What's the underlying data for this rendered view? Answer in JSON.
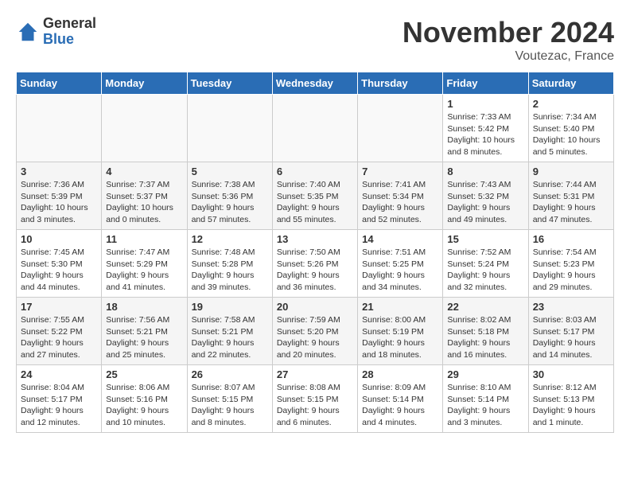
{
  "logo": {
    "general": "General",
    "blue": "Blue"
  },
  "title": "November 2024",
  "location": "Voutezac, France",
  "days_of_week": [
    "Sunday",
    "Monday",
    "Tuesday",
    "Wednesday",
    "Thursday",
    "Friday",
    "Saturday"
  ],
  "weeks": [
    [
      {
        "num": "",
        "info": ""
      },
      {
        "num": "",
        "info": ""
      },
      {
        "num": "",
        "info": ""
      },
      {
        "num": "",
        "info": ""
      },
      {
        "num": "",
        "info": ""
      },
      {
        "num": "1",
        "info": "Sunrise: 7:33 AM\nSunset: 5:42 PM\nDaylight: 10 hours\nand 8 minutes."
      },
      {
        "num": "2",
        "info": "Sunrise: 7:34 AM\nSunset: 5:40 PM\nDaylight: 10 hours\nand 5 minutes."
      }
    ],
    [
      {
        "num": "3",
        "info": "Sunrise: 7:36 AM\nSunset: 5:39 PM\nDaylight: 10 hours\nand 3 minutes."
      },
      {
        "num": "4",
        "info": "Sunrise: 7:37 AM\nSunset: 5:37 PM\nDaylight: 10 hours\nand 0 minutes."
      },
      {
        "num": "5",
        "info": "Sunrise: 7:38 AM\nSunset: 5:36 PM\nDaylight: 9 hours\nand 57 minutes."
      },
      {
        "num": "6",
        "info": "Sunrise: 7:40 AM\nSunset: 5:35 PM\nDaylight: 9 hours\nand 55 minutes."
      },
      {
        "num": "7",
        "info": "Sunrise: 7:41 AM\nSunset: 5:34 PM\nDaylight: 9 hours\nand 52 minutes."
      },
      {
        "num": "8",
        "info": "Sunrise: 7:43 AM\nSunset: 5:32 PM\nDaylight: 9 hours\nand 49 minutes."
      },
      {
        "num": "9",
        "info": "Sunrise: 7:44 AM\nSunset: 5:31 PM\nDaylight: 9 hours\nand 47 minutes."
      }
    ],
    [
      {
        "num": "10",
        "info": "Sunrise: 7:45 AM\nSunset: 5:30 PM\nDaylight: 9 hours\nand 44 minutes."
      },
      {
        "num": "11",
        "info": "Sunrise: 7:47 AM\nSunset: 5:29 PM\nDaylight: 9 hours\nand 41 minutes."
      },
      {
        "num": "12",
        "info": "Sunrise: 7:48 AM\nSunset: 5:28 PM\nDaylight: 9 hours\nand 39 minutes."
      },
      {
        "num": "13",
        "info": "Sunrise: 7:50 AM\nSunset: 5:26 PM\nDaylight: 9 hours\nand 36 minutes."
      },
      {
        "num": "14",
        "info": "Sunrise: 7:51 AM\nSunset: 5:25 PM\nDaylight: 9 hours\nand 34 minutes."
      },
      {
        "num": "15",
        "info": "Sunrise: 7:52 AM\nSunset: 5:24 PM\nDaylight: 9 hours\nand 32 minutes."
      },
      {
        "num": "16",
        "info": "Sunrise: 7:54 AM\nSunset: 5:23 PM\nDaylight: 9 hours\nand 29 minutes."
      }
    ],
    [
      {
        "num": "17",
        "info": "Sunrise: 7:55 AM\nSunset: 5:22 PM\nDaylight: 9 hours\nand 27 minutes."
      },
      {
        "num": "18",
        "info": "Sunrise: 7:56 AM\nSunset: 5:21 PM\nDaylight: 9 hours\nand 25 minutes."
      },
      {
        "num": "19",
        "info": "Sunrise: 7:58 AM\nSunset: 5:21 PM\nDaylight: 9 hours\nand 22 minutes."
      },
      {
        "num": "20",
        "info": "Sunrise: 7:59 AM\nSunset: 5:20 PM\nDaylight: 9 hours\nand 20 minutes."
      },
      {
        "num": "21",
        "info": "Sunrise: 8:00 AM\nSunset: 5:19 PM\nDaylight: 9 hours\nand 18 minutes."
      },
      {
        "num": "22",
        "info": "Sunrise: 8:02 AM\nSunset: 5:18 PM\nDaylight: 9 hours\nand 16 minutes."
      },
      {
        "num": "23",
        "info": "Sunrise: 8:03 AM\nSunset: 5:17 PM\nDaylight: 9 hours\nand 14 minutes."
      }
    ],
    [
      {
        "num": "24",
        "info": "Sunrise: 8:04 AM\nSunset: 5:17 PM\nDaylight: 9 hours\nand 12 minutes."
      },
      {
        "num": "25",
        "info": "Sunrise: 8:06 AM\nSunset: 5:16 PM\nDaylight: 9 hours\nand 10 minutes."
      },
      {
        "num": "26",
        "info": "Sunrise: 8:07 AM\nSunset: 5:15 PM\nDaylight: 9 hours\nand 8 minutes."
      },
      {
        "num": "27",
        "info": "Sunrise: 8:08 AM\nSunset: 5:15 PM\nDaylight: 9 hours\nand 6 minutes."
      },
      {
        "num": "28",
        "info": "Sunrise: 8:09 AM\nSunset: 5:14 PM\nDaylight: 9 hours\nand 4 minutes."
      },
      {
        "num": "29",
        "info": "Sunrise: 8:10 AM\nSunset: 5:14 PM\nDaylight: 9 hours\nand 3 minutes."
      },
      {
        "num": "30",
        "info": "Sunrise: 8:12 AM\nSunset: 5:13 PM\nDaylight: 9 hours\nand 1 minute."
      }
    ]
  ]
}
